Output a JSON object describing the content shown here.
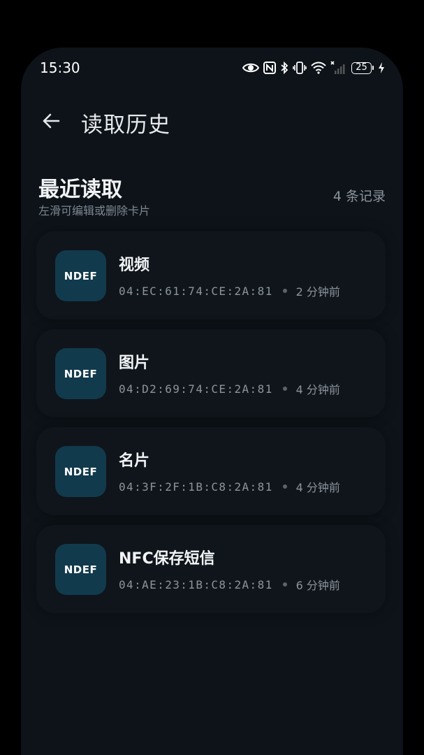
{
  "status_bar": {
    "time": "15:30",
    "battery_level": "25",
    "icons": [
      "eye-icon",
      "nfc-icon",
      "bluetooth-icon",
      "vibrate-icon",
      "wifi-icon",
      "no-signal-icon",
      "battery-icon",
      "charging-icon"
    ]
  },
  "header": {
    "back_icon": "arrow-left-icon",
    "title": "读取历史"
  },
  "section": {
    "title": "最近读取",
    "subtitle": "左滑可编辑或删除卡片",
    "count": "4 条记录"
  },
  "records": [
    {
      "badge": "NDEF",
      "name": "视频",
      "uid": "04:EC:61:74:CE:2A:81",
      "time": "2 分钟前"
    },
    {
      "badge": "NDEF",
      "name": "图片",
      "uid": "04:D2:69:74:CE:2A:81",
      "time": "4 分钟前"
    },
    {
      "badge": "NDEF",
      "name": "名片",
      "uid": "04:3F:2F:1B:C8:2A:81",
      "time": "4 分钟前"
    },
    {
      "badge": "NDEF",
      "name": "NFC保存短信",
      "uid": "04:AE:23:1B:C8:2A:81",
      "time": "6 分钟前"
    }
  ],
  "colors": {
    "background": "#0d1319",
    "badge": "#123a4d",
    "card": "#0f151b"
  }
}
